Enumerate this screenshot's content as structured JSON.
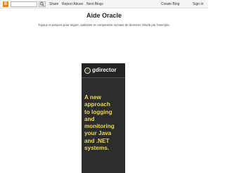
{
  "navbar": {
    "logo_glyph": "B",
    "search_placeholder": "",
    "links": {
      "share": "Share",
      "report": "Report Abuse",
      "next_blog": "Next Blog»",
      "create_blog": "Create Blog",
      "sign_in": "Sign In"
    }
  },
  "blog": {
    "title": "Aide Oracle",
    "description": "Tuyaux et astuces pour migrer, optimiser et comprendre sa base de données Oracle par l'exemple."
  },
  "ad": {
    "brand": "gdirector",
    "lines": [
      "A new",
      "approach",
      "to logging",
      "and",
      "monitoring",
      "your Java",
      "and .NET",
      "systems."
    ]
  },
  "colors": {
    "logo": "#f57d00",
    "ad_background": "#2c2c2c",
    "ad_text": "#e8d94e"
  }
}
